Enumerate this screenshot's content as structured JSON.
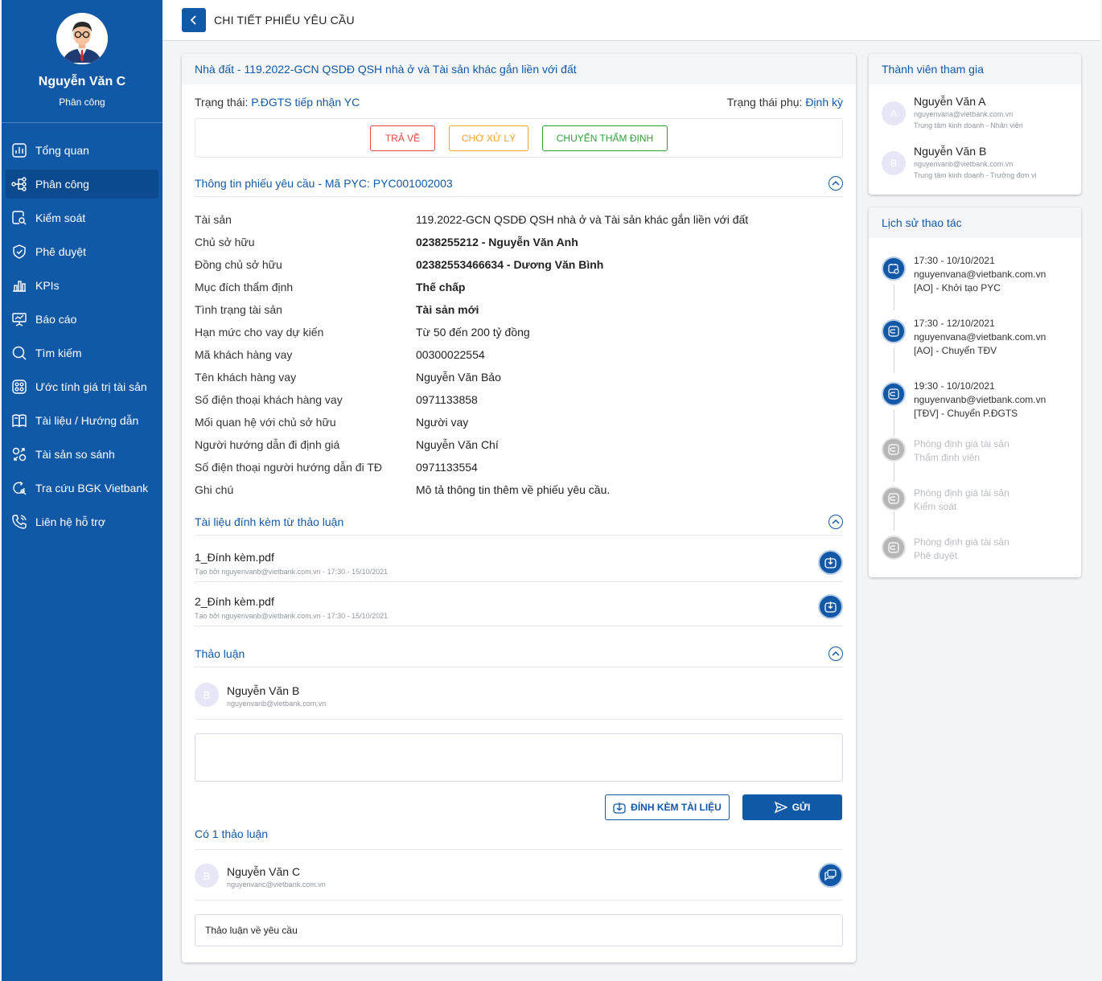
{
  "profile": {
    "name": "Nguyễn Văn C",
    "role": "Phân công"
  },
  "nav": [
    {
      "label": "Tổng quan",
      "icon": "dashboard-icon",
      "active": false
    },
    {
      "label": "Phân công",
      "icon": "share-icon",
      "active": true
    },
    {
      "label": "Kiểm soát",
      "icon": "search-doc-icon",
      "active": false
    },
    {
      "label": "Phê duyệt",
      "icon": "shield-check-icon",
      "active": false
    },
    {
      "label": "KPIs",
      "icon": "bar-chart-icon",
      "active": false
    },
    {
      "label": "Báo cáo",
      "icon": "presentation-icon",
      "active": false
    },
    {
      "label": "Tìm kiếm",
      "icon": "search-icon",
      "active": false
    },
    {
      "label": "Ước tính giá trị tài sản",
      "icon": "calculator-icon",
      "active": false
    },
    {
      "label": "Tài liệu / Hướng dẫn",
      "icon": "book-icon",
      "active": false
    },
    {
      "label": "Tài sản so sánh",
      "icon": "compare-icon",
      "active": false
    },
    {
      "label": "Tra cứu BGK Vietbank",
      "icon": "refresh-search-icon",
      "active": false
    },
    {
      "label": "Liên hệ hỗ trợ",
      "icon": "phone-icon",
      "active": false
    }
  ],
  "header": {
    "title": "CHI TIẾT PHIẾU YÊU CẦU"
  },
  "main": {
    "title": "Nhà đất - 119.2022-GCN QSDĐ QSH nhà ở và Tài sản khác gắn liền với đất",
    "status_label": "Trạng thái:",
    "status_value": "P.ĐGTS tiếp nhận YC",
    "substatus_label": "Trạng thái phụ:",
    "substatus_value": "Định kỳ",
    "actions": {
      "return": "TRẢ VỀ",
      "pending": "CHỜ XỬ LÝ",
      "transfer": "CHUYỂN THẨM ĐỊNH"
    },
    "info_title": "Thông tin phiếu yêu cầu - Mã PYC: PYC001002003",
    "info_rows": [
      {
        "label": "Tài sản",
        "value": "119.2022-GCN QSDĐ QSH nhà ở và Tài sản khác gắn liền với đất",
        "bold": false
      },
      {
        "label": "Chủ sở hữu",
        "value": "0238255212 - Nguyễn Văn Anh",
        "bold": true
      },
      {
        "label": "Đồng chủ sở hữu",
        "value": "02382553466634 - Dương Văn Bình",
        "bold": true
      },
      {
        "label": "Mục đích thẩm định",
        "value": "Thế chấp",
        "bold": true
      },
      {
        "label": "Tình trạng tài sản",
        "value": "Tài sản mới",
        "bold": true
      },
      {
        "label": "Hạn mức cho vay dự kiến",
        "value": "Từ 50 đến 200 tỷ đồng",
        "bold": false
      },
      {
        "label": "Mã khách hàng vay",
        "value": "00300022554",
        "bold": false
      },
      {
        "label": "Tên khách hàng vay",
        "value": "Nguyễn Văn Bảo",
        "bold": false
      },
      {
        "label": "Số điện thoại khách hàng vay",
        "value": "0971133858",
        "bold": false
      },
      {
        "label": "Mối quan hệ với chủ sở hữu",
        "value": "Người vay",
        "bold": false
      },
      {
        "label": "Người hướng dẫn đi định giá",
        "value": "Nguyễn Văn Chí",
        "bold": false
      },
      {
        "label": "Số điện thoại người hướng dẫn đi TĐ",
        "value": "0971133554",
        "bold": false
      },
      {
        "label": "Ghi chú",
        "value": "Mô tả thông tin thêm về phiếu yêu cầu.",
        "bold": false
      }
    ],
    "attach_title": "Tài liệu đính kèm từ thảo luận",
    "files": [
      {
        "name": "1_Đính kèm.pdf",
        "meta": "Tạo bởi nguyenvanb@vietbank.com.vn - 17:30 - 15/10/2021"
      },
      {
        "name": "2_Đính kèm.pdf",
        "meta": "Tạo bởi nguyenvanb@vietbank.com.vn - 17:30 - 15/10/2021"
      }
    ],
    "discussion_title": "Thảo luận",
    "discussion_user": {
      "initial": "B",
      "name": "Nguyễn Văn B",
      "email": "nguyenvanb@vietbank.com.vn"
    },
    "attach_button": "ĐÍNH KÈM TÀI LIỆU",
    "send_button": "GỬI",
    "count_title": "Có 1 thảo luận",
    "comment": {
      "initial": "B",
      "name": "Nguyễn Văn C",
      "email": "nguyenvanc@vietbank.com.vn",
      "text": "Thảo luận về yêu cầu"
    }
  },
  "members": {
    "title": "Thành viên tham gia",
    "items": [
      {
        "initial": "A",
        "name": "Nguyễn Văn A",
        "email": "nguyenvana@vietbank.com.vn",
        "org": "Trung tâm kinh doanh - Nhân viên"
      },
      {
        "initial": "B",
        "name": "Nguyễn Văn B",
        "email": "nguyenvanb@vietbank.com.vn",
        "org": "Trung tâm kinh doanh - Trưởng đơn vị"
      }
    ]
  },
  "history": {
    "title": "Lịch sử thao tác",
    "items": [
      {
        "lines": [
          "17:30 - 10/10/2021",
          "nguyenvana@vietbank.com.vn",
          "[AO] - Khởi tạo PYC"
        ],
        "done": true
      },
      {
        "lines": [
          "17:30 - 12/10/2021",
          "nguyenvana@vietbank.com.vn",
          "[AO] - Chuyển TĐV"
        ],
        "done": true
      },
      {
        "lines": [
          "19:30 - 10/10/2021",
          "nguyenvanb@vietbank.com.vn",
          "[TĐV] - Chuyển P.ĐGTS"
        ],
        "done": true
      },
      {
        "lines": [
          "Phòng định giá tài sản",
          "Thẩm định viên"
        ],
        "done": false
      },
      {
        "lines": [
          "Phòng định giá tài sản",
          "Kiểm soát"
        ],
        "done": false
      },
      {
        "lines": [
          "Phòng định giá tài sản",
          "Phê duyệt"
        ],
        "done": false
      }
    ]
  },
  "colors": {
    "primary": "#1158a7",
    "red": "#e0473e",
    "orange": "#f0a22a",
    "green": "#2f9e37"
  }
}
